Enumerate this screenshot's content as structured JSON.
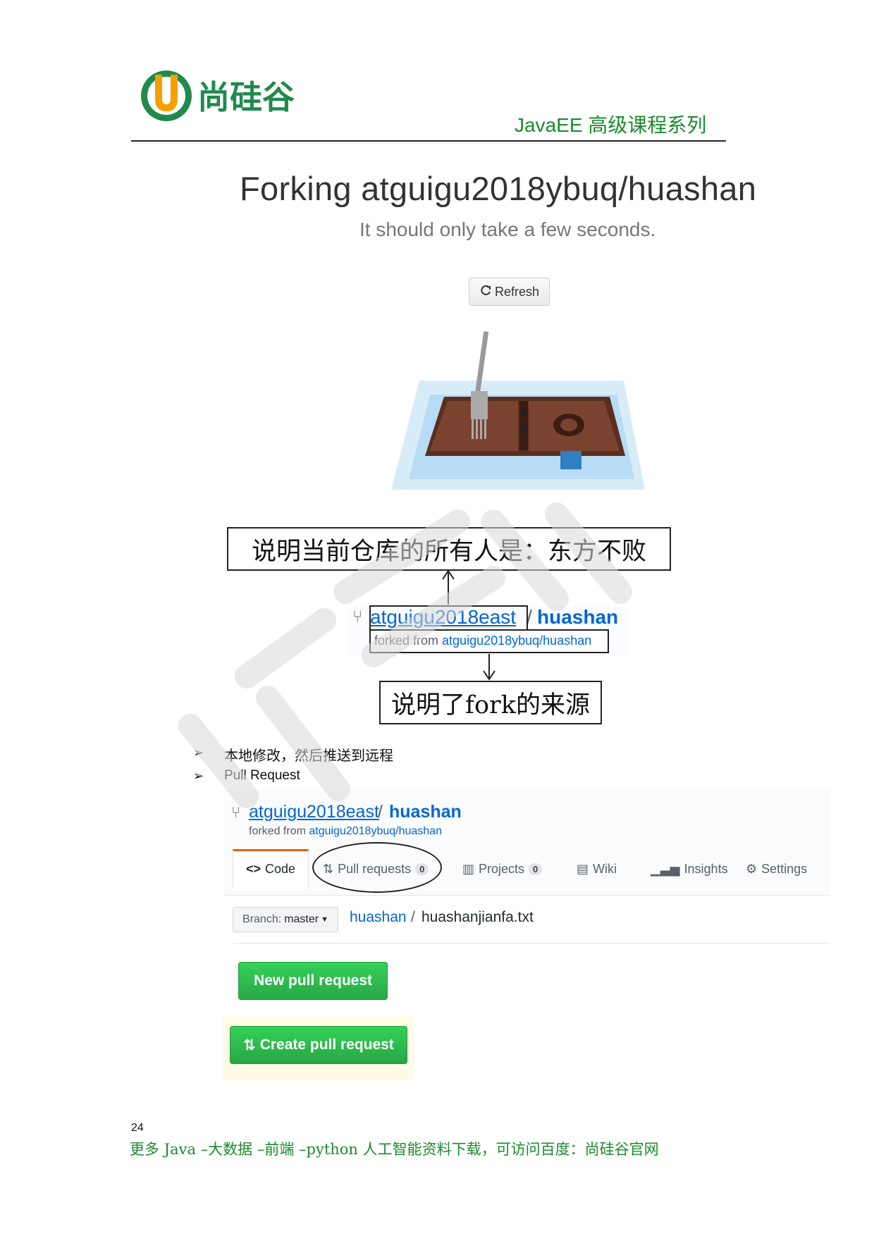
{
  "header": {
    "logo_text": "尚硅谷",
    "series_title": "JavaEE 高级课程系列"
  },
  "forking": {
    "title": "Forking atguigu2018ybuq/huashan",
    "subtitle": "It should only take a few seconds.",
    "refresh_label": "Refresh",
    "refresh_icon": "refresh-icon"
  },
  "annotations": {
    "owner_note": "说明当前仓库的所有人是：东方不败",
    "fork_note": "说明了fork的来源"
  },
  "repo_header_1": {
    "owner": "atguigu2018east",
    "separator": "/",
    "name": "huashan",
    "forked_from_label": "forked from ",
    "forked_from_link": "atguigu2018ybuq/huashan"
  },
  "bullets": [
    {
      "mark": "➢",
      "text": "本地修改，然后推送到远程"
    },
    {
      "mark": "➢",
      "text": "Pull Request"
    }
  ],
  "repo_page": {
    "owner": "atguigu2018east",
    "separator": "/",
    "name": "huashan",
    "forked_from_label": "forked from ",
    "forked_from_link": "atguigu2018ybuq/huashan",
    "tabs": [
      {
        "label": "Code",
        "icon": "code-icon"
      },
      {
        "label": "Pull requests",
        "icon": "pull-request-icon",
        "count": "0"
      },
      {
        "label": "Projects",
        "icon": "project-icon",
        "count": "0"
      },
      {
        "label": "Wiki",
        "icon": "book-icon"
      },
      {
        "label": "Insights",
        "icon": "graph-icon"
      },
      {
        "label": "Settings",
        "icon": "gear-icon"
      }
    ],
    "branch_label": "Branch:",
    "branch_value": "master",
    "path_repo": "huashan",
    "path_separator": "/",
    "path_file": "huashanjianfa.txt",
    "new_pr_label": "New pull request",
    "create_pr_label": "Create pull request"
  },
  "footer": {
    "page_number": "24",
    "text": "更多 Java –大数据 –前端 –python 人工智能资料下载，可访问百度：尚硅谷官网"
  },
  "colors": {
    "brand_green": "#1b8a2e",
    "link_blue": "#0366d6",
    "button_green": "#28a745",
    "active_tab_orange": "#e36209"
  }
}
